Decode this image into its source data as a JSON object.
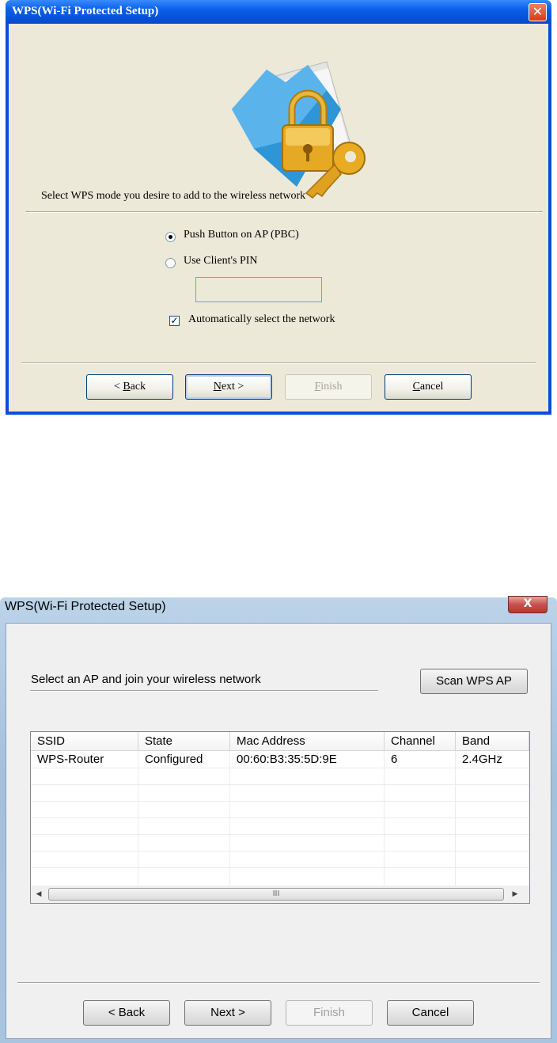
{
  "dialog1": {
    "title": "WPS(Wi-Fi Protected Setup)",
    "close_glyph": "✕",
    "prompt": "Select WPS mode you desire to add to the wireless network",
    "options": {
      "pbc_label": "Push Button on AP (PBC)",
      "pbc_selected": true,
      "pin_label": "Use Client's PIN",
      "pin_selected": false,
      "pin_value": ""
    },
    "auto_select": {
      "label": "Automatically select the network",
      "checked": true
    },
    "buttons": {
      "back_prefix": "< ",
      "back_accel": "B",
      "back_rest": "ack",
      "next_accel": "N",
      "next_rest": "ext >",
      "finish_accel": "F",
      "finish_rest": "inish",
      "cancel_accel": "C",
      "cancel_rest": "ancel"
    },
    "icon": "folder-lock-key-icon"
  },
  "dialog2": {
    "title": "WPS(Wi-Fi Protected Setup)",
    "close_glyph": "X",
    "prompt": "Select an AP and join your wireless network",
    "scan_button": "Scan WPS AP",
    "table": {
      "columns": [
        "SSID",
        "State",
        "Mac Address",
        "Channel",
        "Band"
      ],
      "rows": [
        [
          "WPS-Router",
          "Configured",
          "00:60:B3:35:5D:9E",
          "6",
          "2.4GHz"
        ]
      ]
    },
    "scrollbar": {
      "left_arrow": "◀",
      "right_arrow": "▶",
      "grip": "III"
    },
    "buttons": {
      "back": "< Back",
      "next": "Next >",
      "finish": "Finish",
      "cancel": "Cancel"
    }
  }
}
